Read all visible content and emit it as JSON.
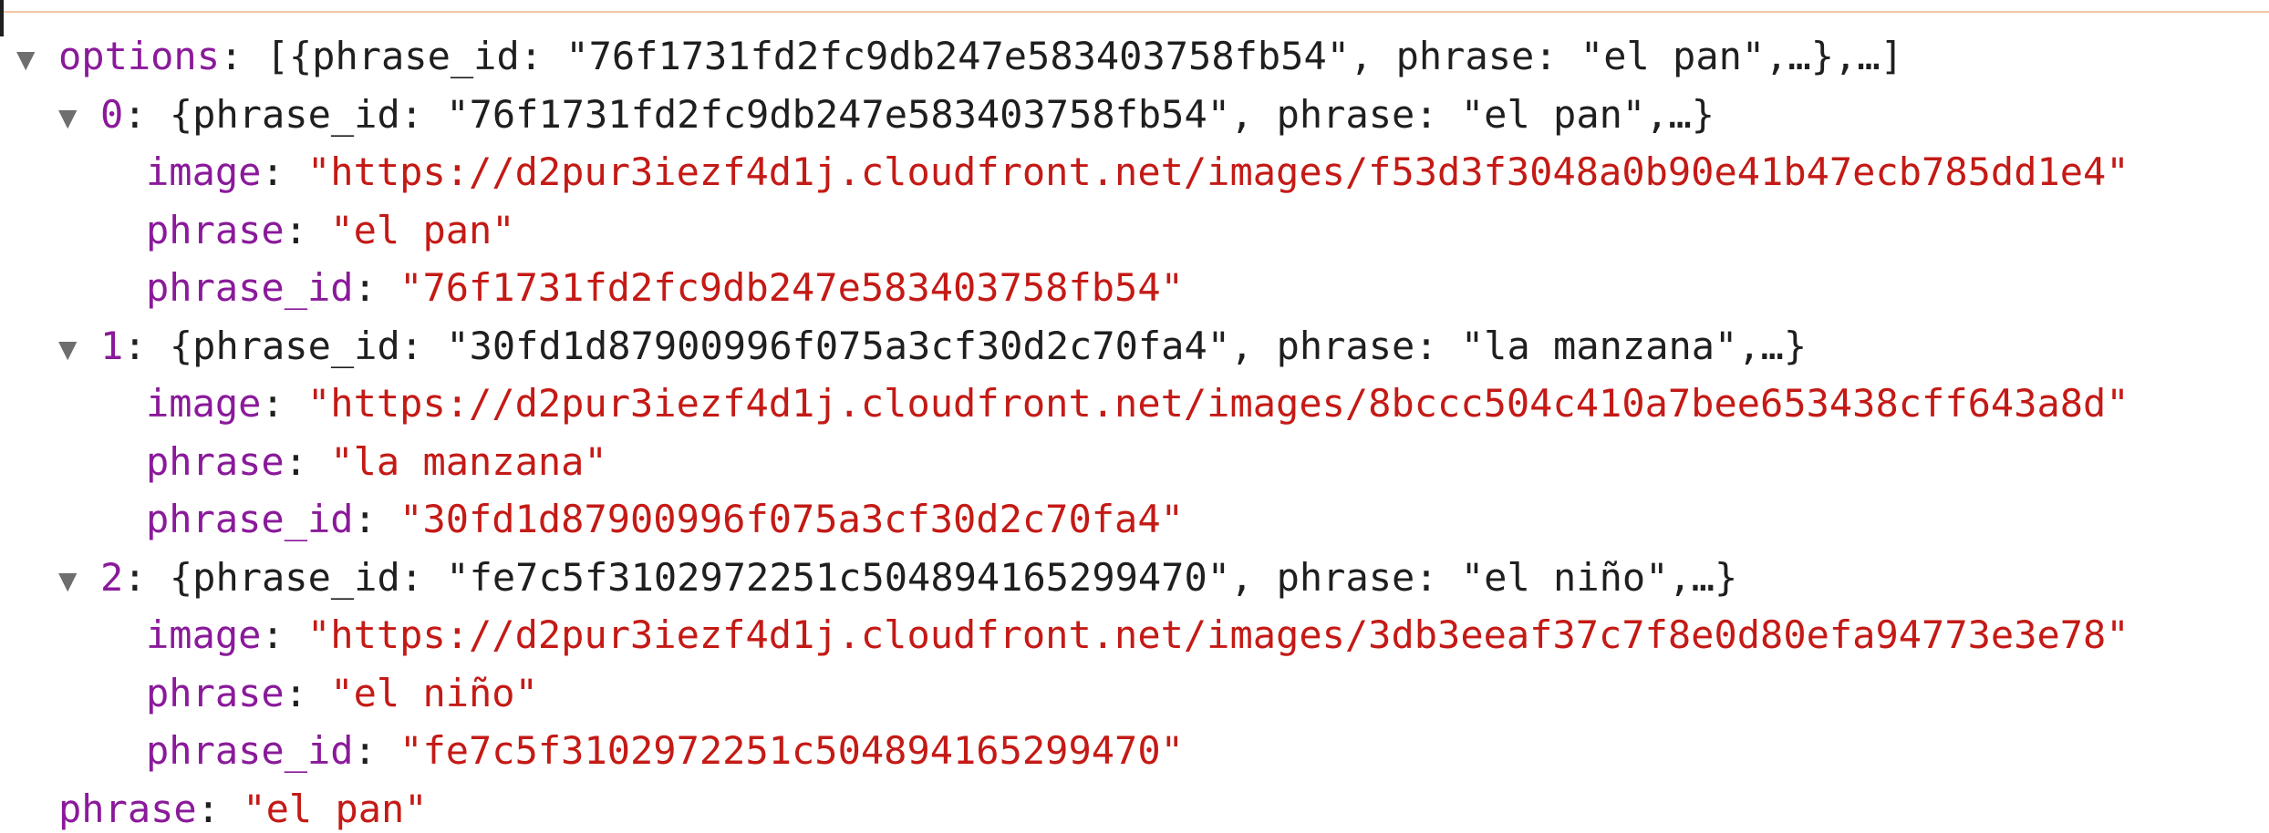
{
  "options_row": {
    "toggle_icon": "triangle-down-icon",
    "key": "options",
    "sep": ": ",
    "summary": "[{phrase_id: \"76f1731fd2fc9db247e583403758fb54\", phrase: \"el pan\",…},…]"
  },
  "items": [
    {
      "index": "0",
      "sep": ": ",
      "summary": "{phrase_id: \"76f1731fd2fc9db247e583403758fb54\", phrase: \"el pan\",…}",
      "image_key": "image",
      "image_value": "\"https://d2pur3iezf4d1j.cloudfront.net/images/f53d3f3048a0b90e41b47ecb785dd1e4\"",
      "phrase_key": "phrase",
      "phrase_value": "\"el pan\"",
      "phrase_id_key": "phrase_id",
      "phrase_id_value": "\"76f1731fd2fc9db247e583403758fb54\""
    },
    {
      "index": "1",
      "sep": ": ",
      "summary": "{phrase_id: \"30fd1d87900996f075a3cf30d2c70fa4\", phrase: \"la manzana\",…}",
      "image_key": "image",
      "image_value": "\"https://d2pur3iezf4d1j.cloudfront.net/images/8bccc504c410a7bee653438cff643a8d\"",
      "phrase_key": "phrase",
      "phrase_value": "\"la manzana\"",
      "phrase_id_key": "phrase_id",
      "phrase_id_value": "\"30fd1d87900996f075a3cf30d2c70fa4\""
    },
    {
      "index": "2",
      "sep": ": ",
      "summary": "{phrase_id: \"fe7c5f3102972251c504894165299470\", phrase: \"el niño\",…}",
      "image_key": "image",
      "image_value": "\"https://d2pur3iezf4d1j.cloudfront.net/images/3db3eeaf37c7f8e0d80efa94773e3e78\"",
      "phrase_key": "phrase",
      "phrase_value": "\"el niño\"",
      "phrase_id_key": "phrase_id",
      "phrase_id_value": "\"fe7c5f3102972251c504894165299470\""
    }
  ],
  "root_phrase": {
    "key": "phrase",
    "value": "\"el pan\""
  },
  "colors": {
    "key": "#8a1a9a",
    "string": "#c41a16",
    "punctuation": "#1f1f1f",
    "toggle": "#6e6e6e"
  }
}
